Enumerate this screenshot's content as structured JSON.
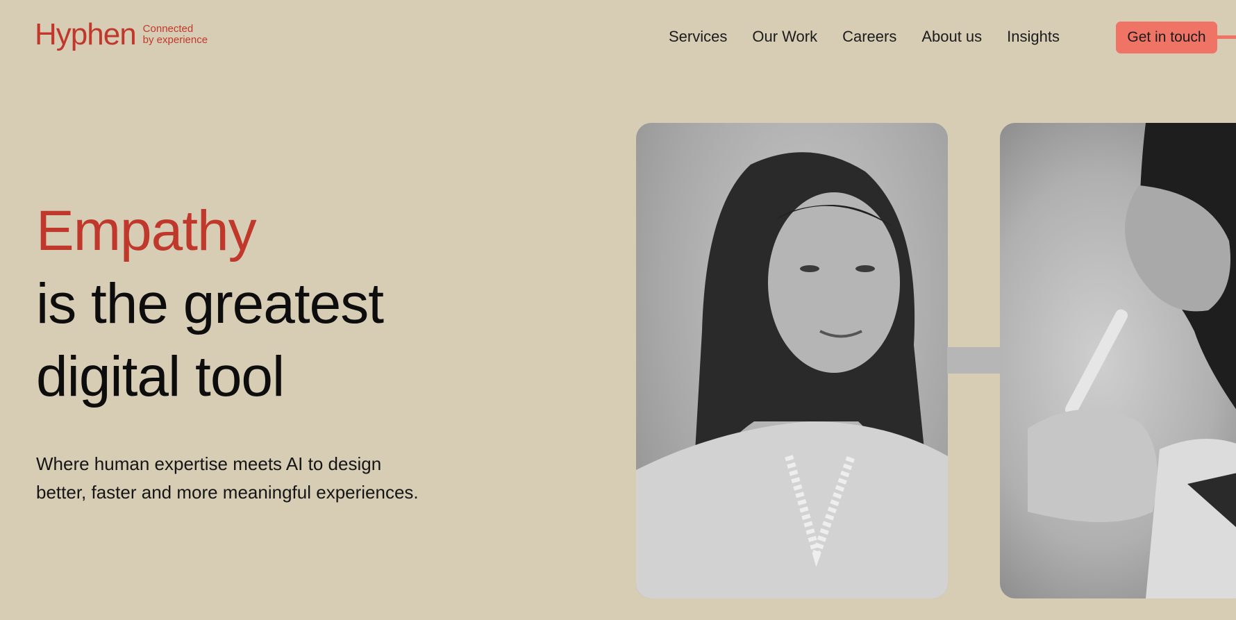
{
  "header": {
    "logo": "Hyphen",
    "tagline_line1": "Connected",
    "tagline_line2": "by experience",
    "nav": [
      "Services",
      "Our Work",
      "Careers",
      "About us",
      "Insights"
    ],
    "cta_label": "Get in touch"
  },
  "hero": {
    "headline_accent": "Empathy",
    "headline_line2": "is the greatest",
    "headline_line3": "digital tool",
    "subtext": "Where human expertise meets AI to design better, faster and more meaningful experiences."
  },
  "colors": {
    "background": "#d7cdb5",
    "accent": "#c0382b",
    "cta": "#f07466"
  }
}
